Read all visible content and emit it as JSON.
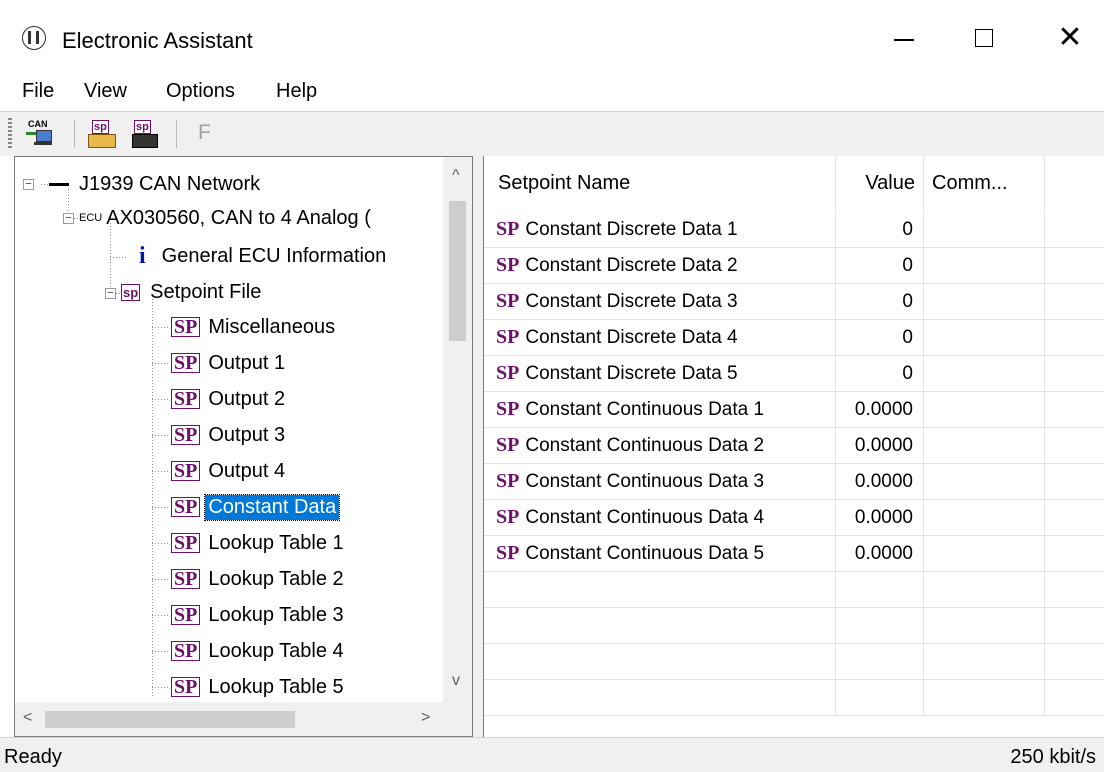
{
  "window": {
    "title": "Electronic Assistant",
    "minimize_glyph": "—",
    "maximize_glyph": "☐",
    "close_glyph": "✕"
  },
  "menu": [
    "File",
    "View",
    "Options",
    "Help"
  ],
  "toolbar": {
    "can_label": "CAN",
    "open_sp_label": "sp",
    "save_sp_label": "sp",
    "flash_label": "F"
  },
  "tree": {
    "network": "J1939 CAN Network",
    "ecu_tag": "ECU",
    "ecu": "AX030560, CAN to 4 Analog (",
    "general_info": "General ECU Information",
    "info_icon": "i",
    "setpoint_file": "Setpoint File",
    "sp_tag": "sp",
    "sp_icon": "SP",
    "children": [
      "Miscellaneous",
      "Output 1",
      "Output 2",
      "Output 3",
      "Output 4",
      "Constant Data",
      "Lookup Table 1",
      "Lookup Table 2",
      "Lookup Table 3",
      "Lookup Table 4",
      "Lookup Table 5"
    ],
    "selected": "Constant Data",
    "expand_glyph": "−",
    "scroll_up": "^",
    "scroll_down": "v",
    "scroll_left": "<",
    "scroll_right": ">"
  },
  "grid": {
    "columns": [
      "Setpoint Name",
      "Value",
      "Comm..."
    ],
    "row_icon": "SP",
    "rows": [
      {
        "name": "Constant Discrete Data 1",
        "value": "0"
      },
      {
        "name": "Constant Discrete Data 2",
        "value": "0"
      },
      {
        "name": "Constant Discrete Data 3",
        "value": "0"
      },
      {
        "name": "Constant Discrete Data 4",
        "value": "0"
      },
      {
        "name": "Constant Discrete Data 5",
        "value": "0"
      },
      {
        "name": "Constant Continuous Data 1",
        "value": "0.0000"
      },
      {
        "name": "Constant Continuous Data 2",
        "value": "0.0000"
      },
      {
        "name": "Constant Continuous Data 3",
        "value": "0.0000"
      },
      {
        "name": "Constant Continuous Data 4",
        "value": "0.0000"
      },
      {
        "name": "Constant Continuous Data 5",
        "value": "0.0000"
      }
    ]
  },
  "status": {
    "left": "Ready",
    "right": "250 kbit/s"
  },
  "colors": {
    "sp_purple": "#6b0f6b",
    "selection": "#0078d7",
    "info_blue": "#0018a8"
  }
}
